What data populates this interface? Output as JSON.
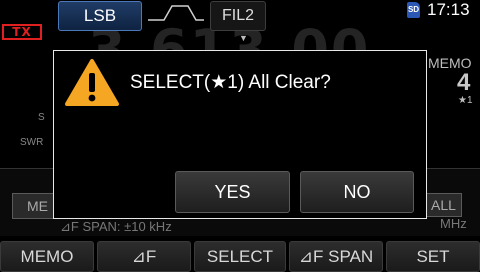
{
  "status_bar": {
    "tx": "TX",
    "mode": "LSB",
    "filter": "FIL2",
    "sd_label": "SD",
    "time": "17:13"
  },
  "background": {
    "frequency_faded": "3.613.00",
    "memo_label": "MEMO",
    "memo_channel": "4",
    "memo_star": "★1",
    "meter_s": "S",
    "meter_swr": "SWR",
    "panel": {
      "left_button": "ME",
      "right_button": "ALL",
      "span_text": "⊿F     SPAN:     ±10 kHz",
      "unit": "MHz"
    }
  },
  "dialog": {
    "message": "SELECT(★1) All Clear?",
    "icon": "warning-icon",
    "icon_color": "#f5a623",
    "yes_label": "YES",
    "no_label": "NO"
  },
  "softkeys": [
    {
      "label": "MEMO"
    },
    {
      "label": "⊿F"
    },
    {
      "label": "SELECT"
    },
    {
      "label": "⊿F SPAN"
    },
    {
      "label": "SET"
    }
  ]
}
